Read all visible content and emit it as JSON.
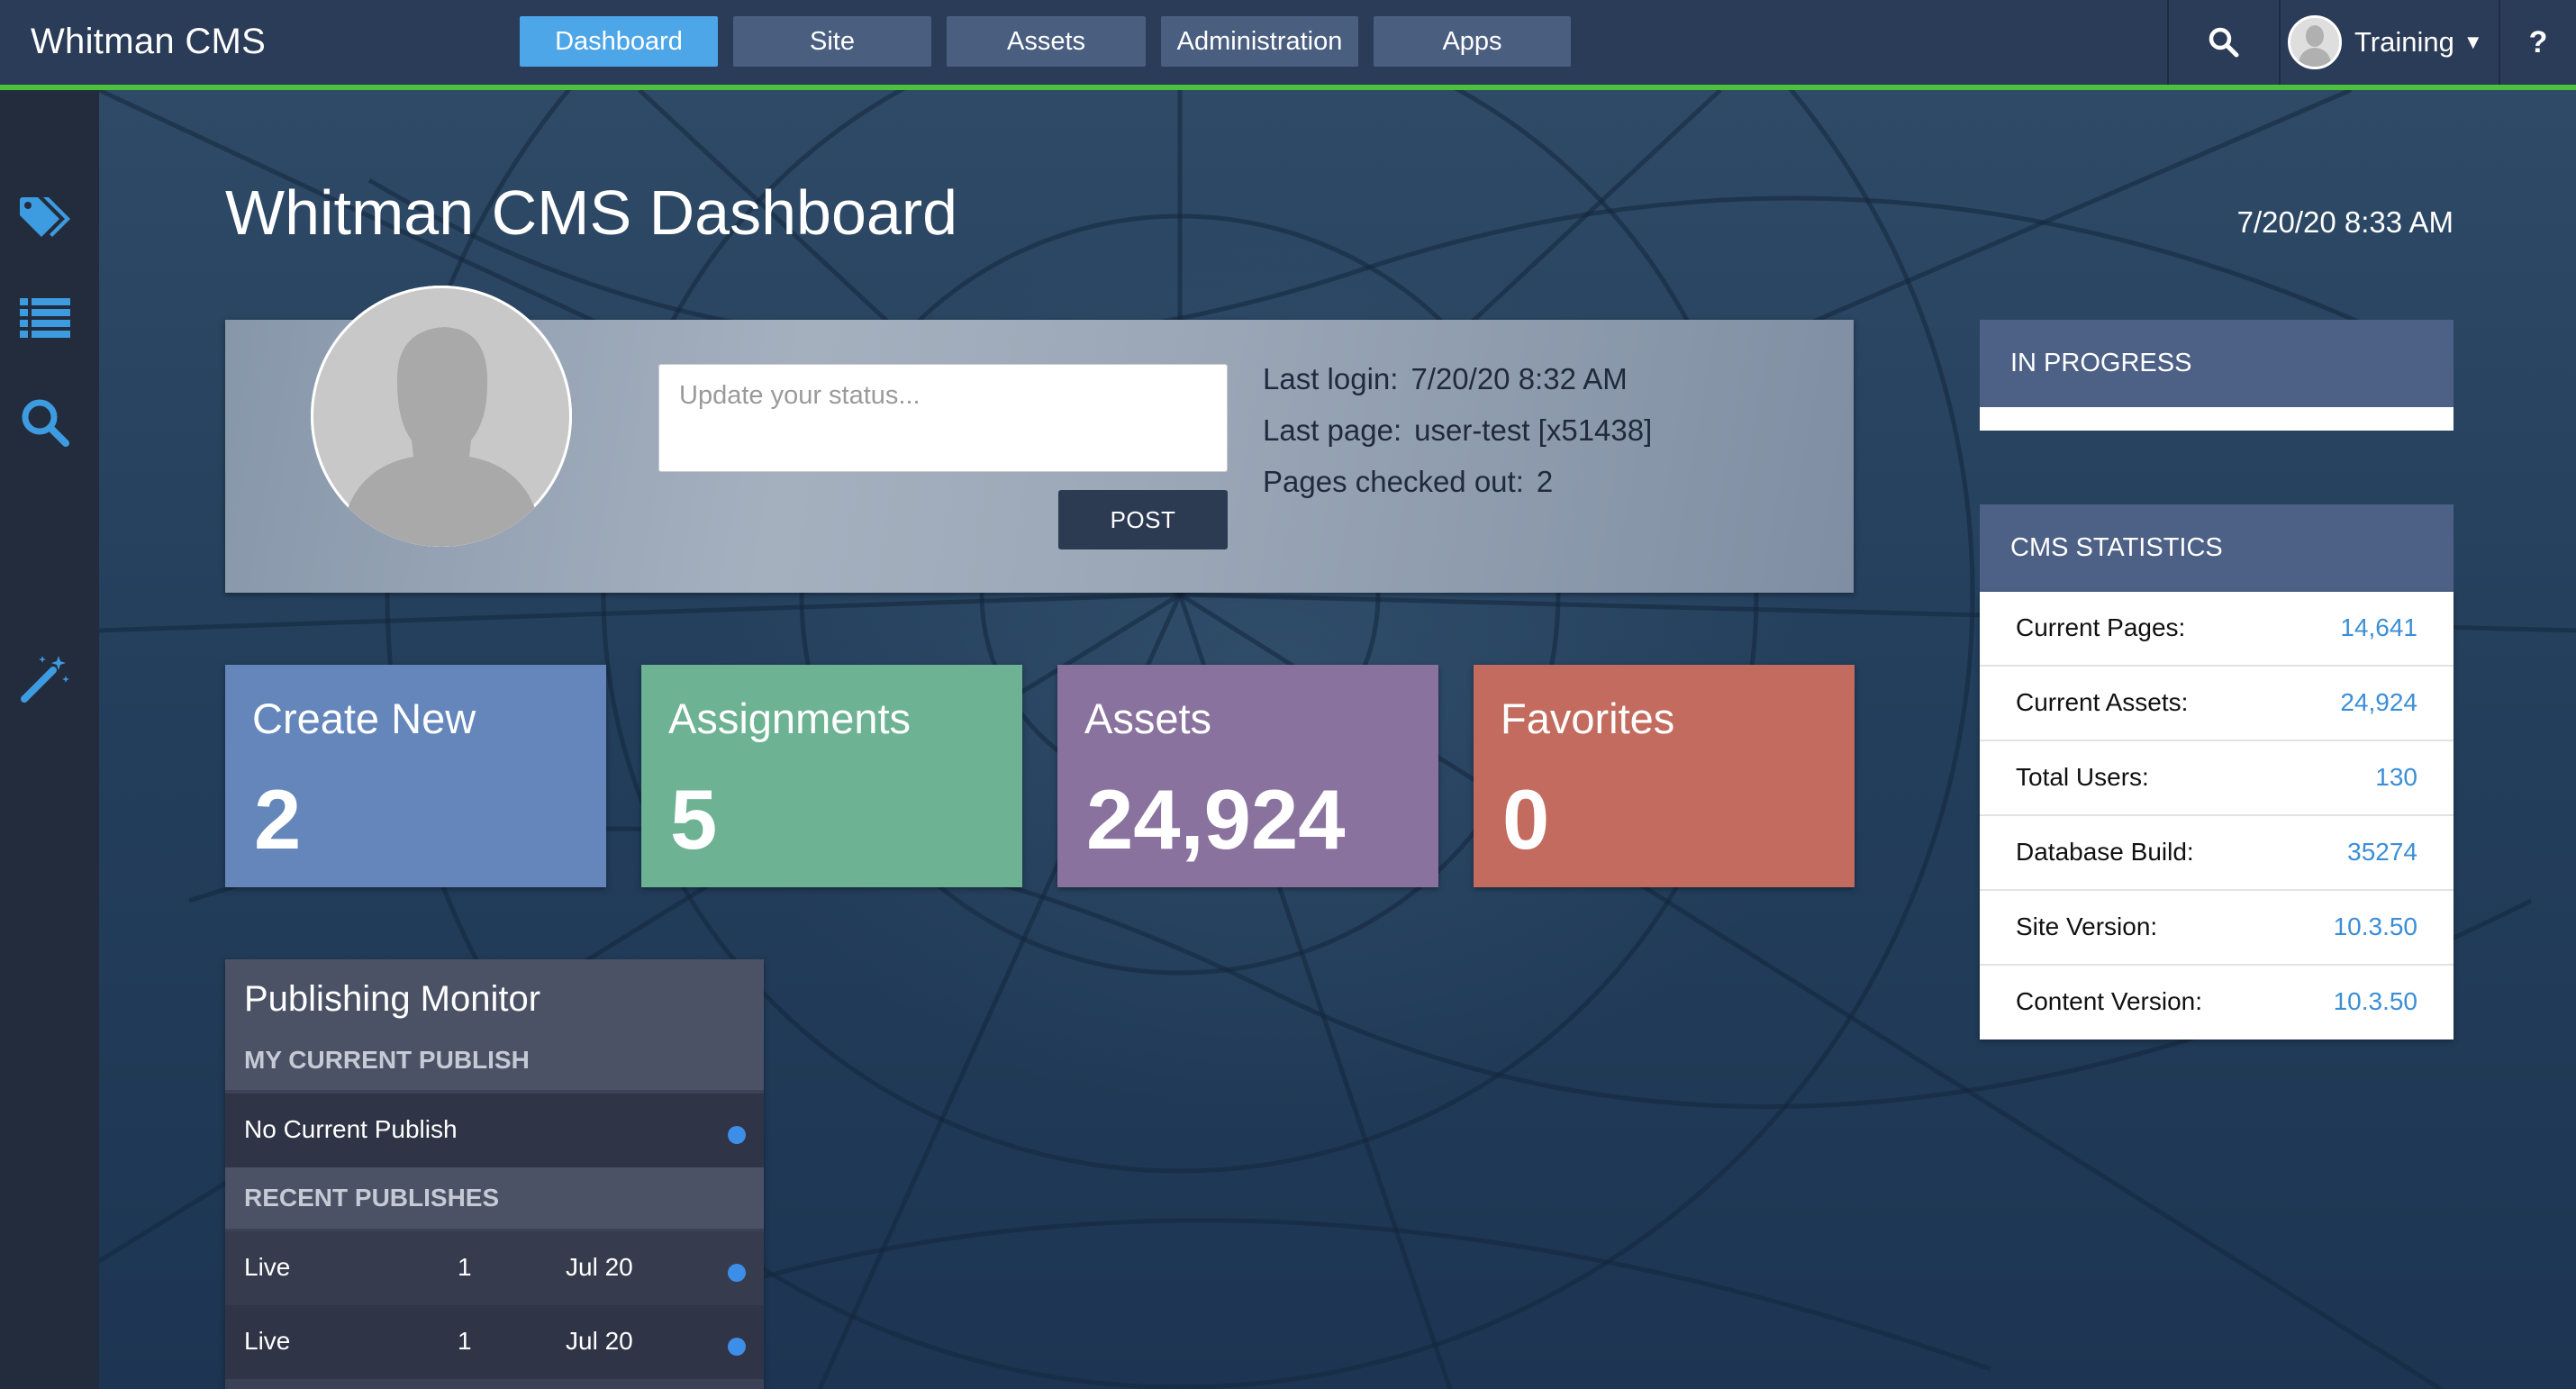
{
  "app": {
    "brand": "Whitman CMS"
  },
  "nav": {
    "tabs": [
      {
        "label": "Dashboard",
        "active": true
      },
      {
        "label": "Site",
        "active": false
      },
      {
        "label": "Assets",
        "active": false
      },
      {
        "label": "Administration",
        "active": false
      },
      {
        "label": "Apps",
        "active": false
      }
    ]
  },
  "user": {
    "name": "Training"
  },
  "help": {
    "label": "?"
  },
  "sidebar": {
    "icons": [
      "tags-icon",
      "list-icon",
      "search-icon",
      "magic-wand-icon"
    ]
  },
  "page": {
    "title": "Whitman CMS Dashboard",
    "datetime": "7/20/20 8:33 AM"
  },
  "profile": {
    "status_placeholder": "Update your status...",
    "post_label": "POST",
    "last_login_label": "Last login:",
    "last_login_value": "7/20/20 8:32 AM",
    "last_page_label": "Last page:",
    "last_page_value": "user-test [x51438]",
    "checked_out_label": "Pages checked out:",
    "checked_out_value": "2"
  },
  "tiles": [
    {
      "label": "Create New",
      "count": "2",
      "color": "#6486bb"
    },
    {
      "label": "Assignments",
      "count": "5",
      "color": "#6cb293"
    },
    {
      "label": "Assets",
      "count": "24,924",
      "color": "#89739e"
    },
    {
      "label": "Favorites",
      "count": "0",
      "color": "#c36b5e"
    }
  ],
  "publishing": {
    "title": "Publishing Monitor",
    "current_header": "MY CURRENT PUBLISH",
    "current_item": "No Current Publish",
    "recent_header": "RECENT PUBLISHES",
    "recent": [
      {
        "status": "Live",
        "count": "1",
        "date": "Jul 20"
      },
      {
        "status": "Live",
        "count": "1",
        "date": "Jul 20"
      }
    ]
  },
  "in_progress": {
    "header": "IN PROGRESS"
  },
  "stats": {
    "header": "CMS STATISTICS",
    "rows": [
      {
        "label": "Current Pages:",
        "value": "14,641"
      },
      {
        "label": "Current Assets:",
        "value": "24,924"
      },
      {
        "label": "Total Users:",
        "value": "130"
      },
      {
        "label": "Database Build:",
        "value": "35274"
      },
      {
        "label": "Site Version:",
        "value": "10.3.50"
      },
      {
        "label": "Content Version:",
        "value": "10.3.50"
      }
    ]
  },
  "colors": {
    "accent_green": "#4cc23c",
    "active_tab": "#4da6e8",
    "icon_blue": "#3d9be0",
    "link_blue": "#3b8ed6"
  }
}
